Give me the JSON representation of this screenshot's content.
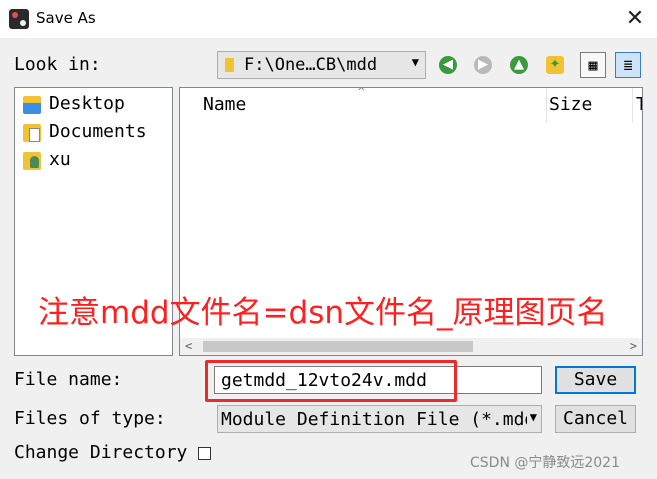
{
  "window": {
    "title": "Save As",
    "close_glyph": "✕"
  },
  "look_in": {
    "label": "Look in:",
    "value": "F:\\One…CB\\mdd",
    "arrow": "▼"
  },
  "toolbar": {
    "back": "◀",
    "forward": "▶",
    "up": "▲",
    "new_folder": "✦",
    "list_view": "▦",
    "details_view": "≣"
  },
  "places": [
    {
      "label": "Desktop",
      "icon": "desktop-icon"
    },
    {
      "label": "Documents",
      "icon": "documents-icon"
    },
    {
      "label": "xu",
      "icon": "user-folder-icon"
    }
  ],
  "file_list": {
    "columns": [
      "Name",
      "Size",
      "T"
    ],
    "sort_glyph": "^",
    "scroll_left": "<",
    "scroll_right": ">"
  },
  "annotation": "注意mdd文件名=dsn文件名_原理图页名",
  "file_name": {
    "label": "File name:",
    "value": "getmdd_12vto24v.mdd"
  },
  "file_type": {
    "label": "Files of type:",
    "value": "Module Definition File (*.mdd)",
    "arrow": "▼"
  },
  "buttons": {
    "save": "Save",
    "cancel": "Cancel"
  },
  "change_directory": {
    "label": "Change Directory"
  },
  "watermark": "CSDN @宁静致远2021",
  "colors": {
    "accent": "#0078d7",
    "highlight": "#e82c2c",
    "annotation": "#ff1f1f"
  }
}
